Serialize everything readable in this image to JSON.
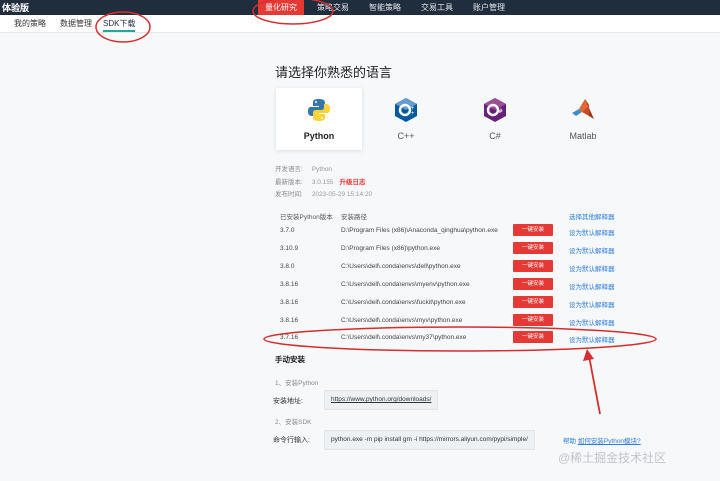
{
  "header": {
    "brand": "体验版",
    "nav": [
      "量化研究",
      "策略交易",
      "智能策略",
      "交易工具",
      "账户管理"
    ]
  },
  "subnav": [
    "我的策略",
    "数据管理",
    "SDK下载"
  ],
  "title": "请选择你熟悉的语言",
  "languages": [
    "Python",
    "C++",
    "C#",
    "Matlab"
  ],
  "info": {
    "lang_label": "开发语言:",
    "lang_value": "Python",
    "version_label": "最新版本:",
    "version_value": "3.0.155",
    "changelog": "升级日志",
    "date_label": "发布时间:",
    "date_value": "2023-05-29 15:14:20"
  },
  "table": {
    "col_version": "已安装Python版本",
    "col_path": "安装路径",
    "choose_link": "选择其他解释器",
    "install_label": "一键安装",
    "default_label": "设为默认解释器",
    "rows": [
      {
        "version": "3.7.0",
        "path": "D:\\Program Files (x86)\\Anaconda_qinghua\\python.exe"
      },
      {
        "version": "3.10.9",
        "path": "D:\\Program Files (x86)\\python.exe"
      },
      {
        "version": "3.8.0",
        "path": "C:\\Users\\dell\\.conda\\envs\\dell\\python.exe"
      },
      {
        "version": "3.8.16",
        "path": "C:\\Users\\dell\\.conda\\envs\\myenv\\python.exe"
      },
      {
        "version": "3.8.16",
        "path": "C:\\Users\\dell\\.conda\\envs\\fuckit\\python.exe"
      },
      {
        "version": "3.8.16",
        "path": "C:\\Users\\dell\\.conda\\envs\\myv\\python.exe"
      },
      {
        "version": "3.7.16",
        "path": "C:\\Users\\dell\\.conda\\envs\\my37\\python.exe"
      }
    ]
  },
  "manual": {
    "title": "手动安装",
    "step1": "1、安装Python",
    "address_label": "安装地址:",
    "address_value": "https://www.python.org/downloads/",
    "step2": "2、安装SDK",
    "cmd_label": "命令行输入:",
    "cmd_value": "python.exe -m pip install gm -i https://mirrors.aliyun.com/pypi/simple/",
    "help_prefix": "帮助",
    "help_link": "如何安装Python模块?"
  },
  "watermark": "@稀土掘金技术社区",
  "colors": {
    "topbar": "#1f2d3d",
    "accent_red": "#e53935",
    "link_blue": "#2a7de1",
    "annotation_red": "#d32f2f"
  }
}
